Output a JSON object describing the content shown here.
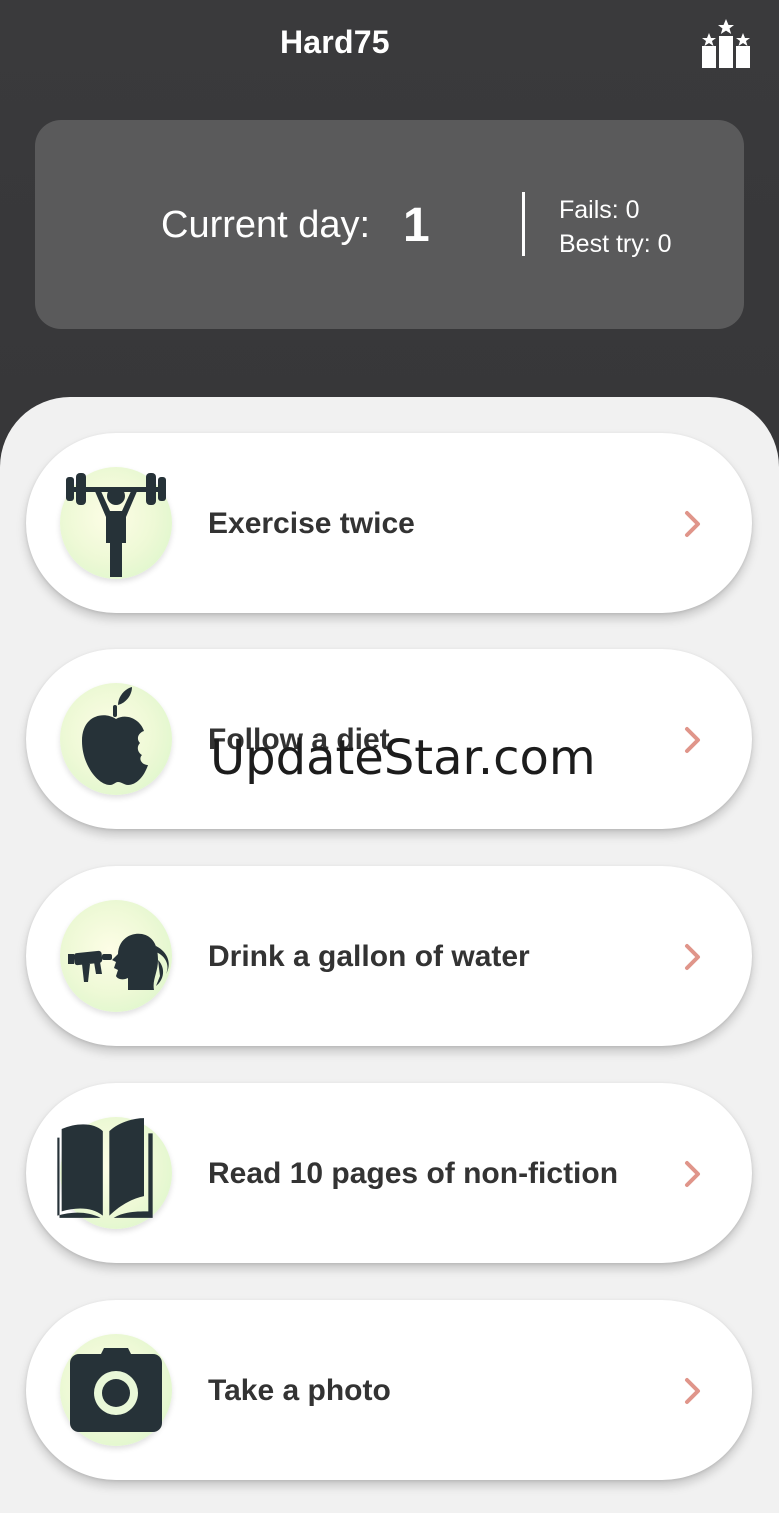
{
  "app": {
    "title": "Hard75"
  },
  "stats": {
    "current_day_label": "Current day:",
    "current_day_value": "1",
    "fails": "Fails: 0",
    "best_try": "Best try: 0"
  },
  "tasks": [
    {
      "label": "Exercise twice",
      "icon": "weightlifter-icon"
    },
    {
      "label": "Follow a diet",
      "icon": "apple-icon"
    },
    {
      "label": "Drink a gallon of water",
      "icon": "drinking-water-icon"
    },
    {
      "label": "Read 10 pages of non-fiction",
      "icon": "open-book-icon"
    },
    {
      "label": "Take a photo",
      "icon": "camera-icon"
    }
  ],
  "watermark": "UpdateStar.com",
  "colors": {
    "header_bg": "#333335",
    "stats_card": "#5a5a5b",
    "sheet_bg": "#f1f1f1",
    "card_bg": "#ffffff",
    "icon_fill": "#263238",
    "chevron": "#e0958a",
    "label_text": "#333333"
  }
}
